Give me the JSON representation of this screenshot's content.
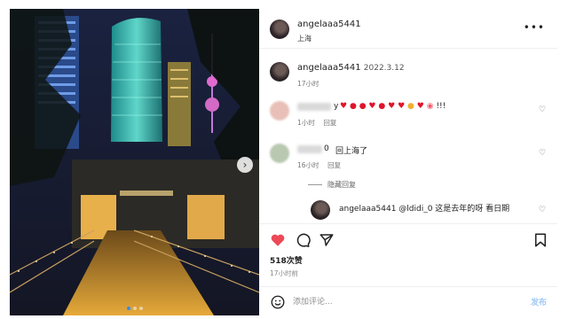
{
  "post": {
    "author": "angelaaa5441",
    "location": "上海",
    "more_icon": "more-dots-icon"
  },
  "caption": {
    "author": "angelaaa5441",
    "date": "2022.3.12",
    "age": "17小时"
  },
  "comments": [
    {
      "name_visible": "y",
      "text_suffix": "!!!",
      "emoji": [
        "heart",
        "kiss-lips",
        "kiss-lips",
        "heart",
        "heart-eyes",
        "heart",
        "heart",
        "heart-eyes",
        "heart",
        "kiss-face"
      ],
      "age": "1小时",
      "reply_label": "回复"
    },
    {
      "name_visible": "0",
      "text": "回上海了",
      "age": "16小时",
      "reply_label": "回复"
    }
  ],
  "hidden_replies_label": "隐藏回复",
  "reply": {
    "author": "angelaaa5441",
    "text": "@ldidi_0 这是去年的呀 看日期"
  },
  "actions": {
    "like_icon": "heart-filled-icon",
    "comment_icon": "comment-icon",
    "share_icon": "send-icon",
    "save_icon": "bookmark-icon",
    "like_color": "#ed4956"
  },
  "likes_label": "518次赞",
  "post_age": "17小时前",
  "comment_box": {
    "emoji_icon": "smiley-icon",
    "placeholder": "添加评论...",
    "post_label": "发布"
  },
  "carousel": {
    "current": 1,
    "count": 3,
    "next_icon": "chevron-right-icon"
  },
  "colors": {
    "accent_blue": "#2f8cff",
    "post_disabled": "#9fc9f6"
  }
}
